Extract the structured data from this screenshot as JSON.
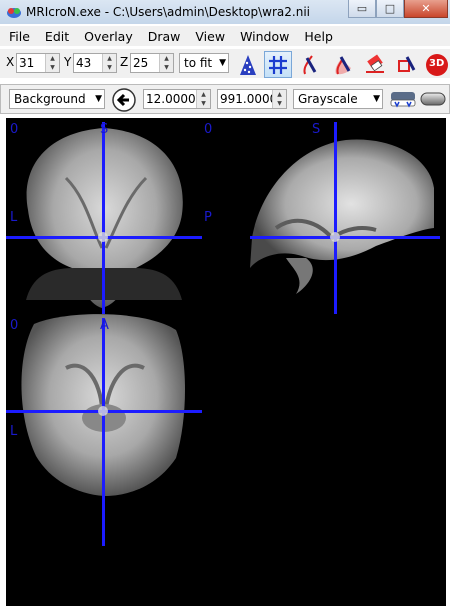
{
  "window": {
    "title": "MRIcroN.exe - C:\\Users\\admin\\Desktop\\wra2.nii",
    "minimize": "▭",
    "maximize": "□",
    "close": "✕"
  },
  "menu": [
    "File",
    "Edit",
    "Overlay",
    "Draw",
    "View",
    "Window",
    "Help"
  ],
  "coords": {
    "x_label": "X",
    "x_value": "31",
    "y_label": "Y",
    "y_value": "43",
    "z_label": "Z",
    "z_value": "25"
  },
  "zoom": {
    "value": "to fit"
  },
  "toolbar_icons": [
    "xbar-icon",
    "crosshair-grid-icon",
    "pen-icon",
    "pen-fill-icon",
    "eraser-icon",
    "draw-shape-icon",
    "render-3d-icon"
  ],
  "render_3d_label": "3D",
  "layer": {
    "value": "Background"
  },
  "intensity": {
    "min": "12.0000",
    "max": "991.0000"
  },
  "colormap": {
    "value": "Grayscale"
  },
  "views": {
    "coronal": {
      "value": "0",
      "top": "S",
      "left": "L"
    },
    "sagittal": {
      "value": "0",
      "top": "S",
      "left": "P"
    },
    "axial": {
      "value": "0",
      "top": "A",
      "left": "L"
    }
  },
  "colors": {
    "crosshair": "#1c1cff",
    "label": "#1a1acc",
    "canvas": "#000000"
  }
}
